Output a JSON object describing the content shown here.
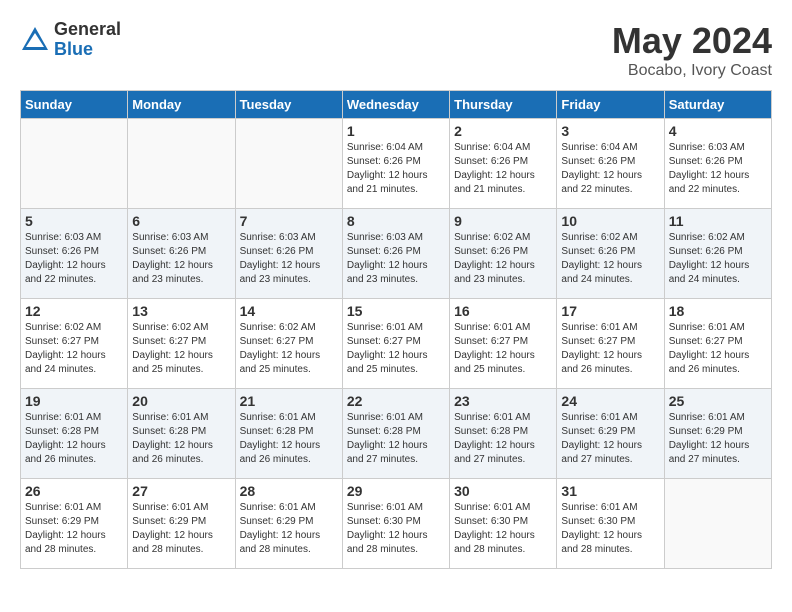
{
  "header": {
    "logo_general": "General",
    "logo_blue": "Blue",
    "month_title": "May 2024",
    "location": "Bocabo, Ivory Coast"
  },
  "weekdays": [
    "Sunday",
    "Monday",
    "Tuesday",
    "Wednesday",
    "Thursday",
    "Friday",
    "Saturday"
  ],
  "weeks": [
    [
      {
        "day": "",
        "info": ""
      },
      {
        "day": "",
        "info": ""
      },
      {
        "day": "",
        "info": ""
      },
      {
        "day": "1",
        "info": "Sunrise: 6:04 AM\nSunset: 6:26 PM\nDaylight: 12 hours\nand 21 minutes."
      },
      {
        "day": "2",
        "info": "Sunrise: 6:04 AM\nSunset: 6:26 PM\nDaylight: 12 hours\nand 21 minutes."
      },
      {
        "day": "3",
        "info": "Sunrise: 6:04 AM\nSunset: 6:26 PM\nDaylight: 12 hours\nand 22 minutes."
      },
      {
        "day": "4",
        "info": "Sunrise: 6:03 AM\nSunset: 6:26 PM\nDaylight: 12 hours\nand 22 minutes."
      }
    ],
    [
      {
        "day": "5",
        "info": "Sunrise: 6:03 AM\nSunset: 6:26 PM\nDaylight: 12 hours\nand 22 minutes."
      },
      {
        "day": "6",
        "info": "Sunrise: 6:03 AM\nSunset: 6:26 PM\nDaylight: 12 hours\nand 23 minutes."
      },
      {
        "day": "7",
        "info": "Sunrise: 6:03 AM\nSunset: 6:26 PM\nDaylight: 12 hours\nand 23 minutes."
      },
      {
        "day": "8",
        "info": "Sunrise: 6:03 AM\nSunset: 6:26 PM\nDaylight: 12 hours\nand 23 minutes."
      },
      {
        "day": "9",
        "info": "Sunrise: 6:02 AM\nSunset: 6:26 PM\nDaylight: 12 hours\nand 23 minutes."
      },
      {
        "day": "10",
        "info": "Sunrise: 6:02 AM\nSunset: 6:26 PM\nDaylight: 12 hours\nand 24 minutes."
      },
      {
        "day": "11",
        "info": "Sunrise: 6:02 AM\nSunset: 6:26 PM\nDaylight: 12 hours\nand 24 minutes."
      }
    ],
    [
      {
        "day": "12",
        "info": "Sunrise: 6:02 AM\nSunset: 6:27 PM\nDaylight: 12 hours\nand 24 minutes."
      },
      {
        "day": "13",
        "info": "Sunrise: 6:02 AM\nSunset: 6:27 PM\nDaylight: 12 hours\nand 25 minutes."
      },
      {
        "day": "14",
        "info": "Sunrise: 6:02 AM\nSunset: 6:27 PM\nDaylight: 12 hours\nand 25 minutes."
      },
      {
        "day": "15",
        "info": "Sunrise: 6:01 AM\nSunset: 6:27 PM\nDaylight: 12 hours\nand 25 minutes."
      },
      {
        "day": "16",
        "info": "Sunrise: 6:01 AM\nSunset: 6:27 PM\nDaylight: 12 hours\nand 25 minutes."
      },
      {
        "day": "17",
        "info": "Sunrise: 6:01 AM\nSunset: 6:27 PM\nDaylight: 12 hours\nand 26 minutes."
      },
      {
        "day": "18",
        "info": "Sunrise: 6:01 AM\nSunset: 6:27 PM\nDaylight: 12 hours\nand 26 minutes."
      }
    ],
    [
      {
        "day": "19",
        "info": "Sunrise: 6:01 AM\nSunset: 6:28 PM\nDaylight: 12 hours\nand 26 minutes."
      },
      {
        "day": "20",
        "info": "Sunrise: 6:01 AM\nSunset: 6:28 PM\nDaylight: 12 hours\nand 26 minutes."
      },
      {
        "day": "21",
        "info": "Sunrise: 6:01 AM\nSunset: 6:28 PM\nDaylight: 12 hours\nand 26 minutes."
      },
      {
        "day": "22",
        "info": "Sunrise: 6:01 AM\nSunset: 6:28 PM\nDaylight: 12 hours\nand 27 minutes."
      },
      {
        "day": "23",
        "info": "Sunrise: 6:01 AM\nSunset: 6:28 PM\nDaylight: 12 hours\nand 27 minutes."
      },
      {
        "day": "24",
        "info": "Sunrise: 6:01 AM\nSunset: 6:29 PM\nDaylight: 12 hours\nand 27 minutes."
      },
      {
        "day": "25",
        "info": "Sunrise: 6:01 AM\nSunset: 6:29 PM\nDaylight: 12 hours\nand 27 minutes."
      }
    ],
    [
      {
        "day": "26",
        "info": "Sunrise: 6:01 AM\nSunset: 6:29 PM\nDaylight: 12 hours\nand 28 minutes."
      },
      {
        "day": "27",
        "info": "Sunrise: 6:01 AM\nSunset: 6:29 PM\nDaylight: 12 hours\nand 28 minutes."
      },
      {
        "day": "28",
        "info": "Sunrise: 6:01 AM\nSunset: 6:29 PM\nDaylight: 12 hours\nand 28 minutes."
      },
      {
        "day": "29",
        "info": "Sunrise: 6:01 AM\nSunset: 6:30 PM\nDaylight: 12 hours\nand 28 minutes."
      },
      {
        "day": "30",
        "info": "Sunrise: 6:01 AM\nSunset: 6:30 PM\nDaylight: 12 hours\nand 28 minutes."
      },
      {
        "day": "31",
        "info": "Sunrise: 6:01 AM\nSunset: 6:30 PM\nDaylight: 12 hours\nand 28 minutes."
      },
      {
        "day": "",
        "info": ""
      }
    ]
  ]
}
